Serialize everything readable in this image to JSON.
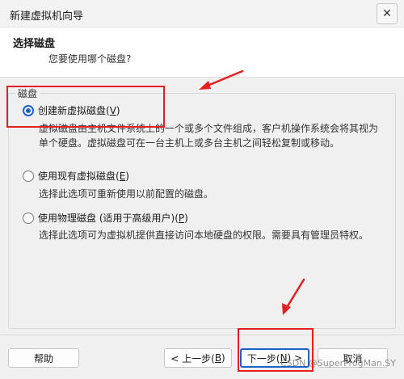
{
  "window": {
    "title": "新建虚拟机向导",
    "close_glyph": "✕"
  },
  "header": {
    "title": "选择磁盘",
    "subtitle": "您要使用哪个磁盘?"
  },
  "disk_group": {
    "legend": "磁盘",
    "options": [
      {
        "label": "创建新虚拟磁盘",
        "accel": "V",
        "suffix": "",
        "checked": true,
        "description": "虚拟磁盘由主机文件系统上的一个或多个文件组成，客户机操作系统会将其视为单个硬盘。虚拟磁盘可在一台主机上或多台主机之间轻松复制或移动。"
      },
      {
        "label": "使用现有虚拟磁盘",
        "accel": "E",
        "suffix": "",
        "checked": false,
        "description": "选择此选项可重新使用以前配置的磁盘。"
      },
      {
        "label": "使用物理磁盘 (适用于高级用户)",
        "accel": "P",
        "suffix": "",
        "checked": false,
        "description": "选择此选项可为虚拟机提供直接访问本地硬盘的权限。需要具有管理员特权。"
      }
    ]
  },
  "footer": {
    "help": "帮助",
    "back_pre": "< 上一步(",
    "back_accel": "B",
    "back_post": ")",
    "next_pre": "下一步(",
    "next_accel": "N",
    "next_post": ") >",
    "cancel": "取消"
  },
  "watermark": "CSDN @SuperProgMan.SY",
  "annotation_color": "#e51f1f",
  "accent_color": "#1d63c7"
}
